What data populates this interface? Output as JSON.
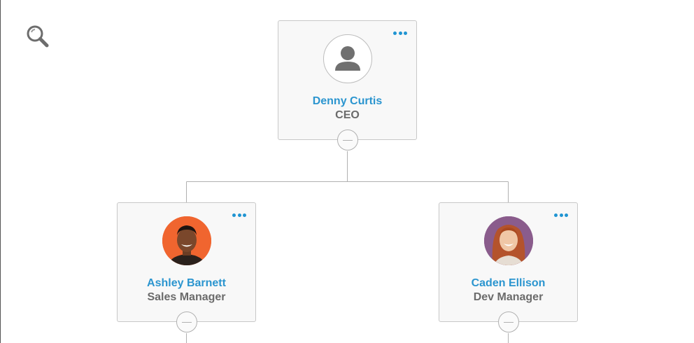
{
  "toolbar": {
    "search_icon": "search-icon"
  },
  "nodes": [
    {
      "name": "Denny Curtis",
      "title": "CEO",
      "avatar": "person-placeholder-icon"
    },
    {
      "name": "Ashley Barnett",
      "title": "Sales Manager",
      "avatar": "photo",
      "avatar_bg": "#f0652f"
    },
    {
      "name": "Caden Ellison",
      "title": "Dev Manager",
      "avatar": "photo",
      "avatar_bg": "#8a5c8c"
    }
  ],
  "colors": {
    "accent": "#1f94d2",
    "name": "#2b95cf",
    "title": "#6b6b6b",
    "line": "#b0b0b0",
    "card_bg": "#f8f8f8"
  }
}
